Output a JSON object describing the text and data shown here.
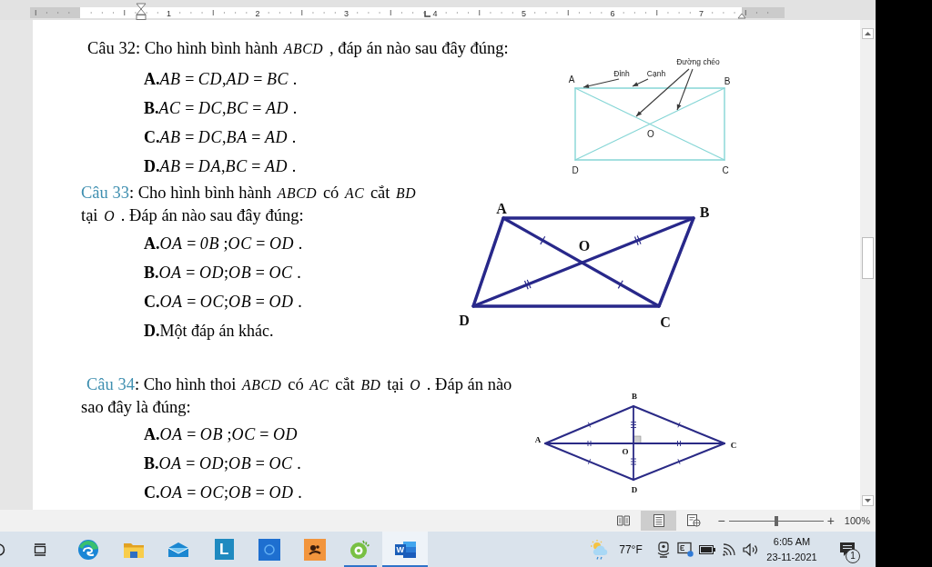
{
  "ruler": {
    "numbers": [
      "1",
      "2",
      "3",
      "4",
      "5",
      "6",
      "7"
    ]
  },
  "questions": [
    {
      "label": "Câu 32",
      "color": "#000000",
      "text": ": Cho hình bình hành *ABCD* , đáp án nào sau đây đúng:",
      "options": [
        {
          "label": "A.",
          "text": "*AB* = *CD*,*AD* = *BC* ."
        },
        {
          "label": "B.",
          "text": "*AC* = *DC*,*BC* = *AD* ."
        },
        {
          "label": "C.",
          "text": "*AB* = *DC*,*BA* = *AD* ."
        },
        {
          "label": "D.",
          "text": "*AB* = *DA*,*BC* = *AD* ."
        }
      ],
      "figure": {
        "kind": "rectangle",
        "vertices": [
          "A",
          "B",
          "D",
          "C"
        ],
        "center": "O",
        "callouts": [
          "Đỉnh",
          "Cạnh",
          "Đường chéo"
        ]
      }
    },
    {
      "label": "Câu 33",
      "color": "#3f8fb0",
      "text": ": Cho hình bình hành *ABCD* có *AC* cắt *BD* tại *O* . Đáp án nào sau đây đúng:",
      "options": [
        {
          "label": "A.",
          "text": "*OA* = *0B* ;*OC* = *OD* ."
        },
        {
          "label": "B.",
          "text": "*OA* = *OD*;*OB* = *OC* ."
        },
        {
          "label": "C.",
          "text": "*OA* = *OC*;*OB* = *OD* ."
        },
        {
          "label": "D.",
          "text": "Một đáp án khác."
        }
      ],
      "figure": {
        "kind": "parallelogram",
        "vertices": [
          "A",
          "B",
          "D",
          "C"
        ],
        "center": "O"
      }
    },
    {
      "label": "Câu 34",
      "color": "#3f8fb0",
      "text": ": Cho hình thoi *ABCD* có *AC* cắt *BD* tại *O* . Đáp án nào sao đây là đúng:",
      "options": [
        {
          "label": "A.",
          "text": "*OA* = *OB* ;*OC* = *OD*"
        },
        {
          "label": "B.",
          "text": "*OA* = *OD*;*OB* = *OC* ."
        },
        {
          "label": "C.",
          "text": "*OA* = *OC*;*OB* = *OD* ."
        }
      ],
      "figure": {
        "kind": "rhombus",
        "vertices": [
          "B",
          "A",
          "C",
          "D"
        ],
        "center": "O"
      }
    }
  ],
  "status_bar": {
    "views": [
      {
        "kind": "read",
        "selected": false
      },
      {
        "kind": "print",
        "selected": true
      },
      {
        "kind": "web",
        "selected": false
      }
    ],
    "zoom": {
      "minus": "−",
      "plus": "+",
      "level": 0.5,
      "reading": "100%"
    }
  },
  "taskbar": {
    "buttons": [
      {
        "kind": "search"
      },
      {
        "kind": "task_view"
      }
    ],
    "apps": [
      {
        "kind": "browser",
        "running": false,
        "selected": false
      },
      {
        "kind": "folder",
        "running": false,
        "selected": false
      },
      {
        "kind": "mail",
        "running": false,
        "selected": false
      },
      {
        "kind": "letter_tile",
        "glyph": "L",
        "running": false,
        "selected": false
      },
      {
        "kind": "ring_tile",
        "running": false,
        "selected": false
      },
      {
        "kind": "figure_tile",
        "running": false,
        "selected": false
      },
      {
        "kind": "spiral",
        "running": true,
        "selected": false
      },
      {
        "kind": "word",
        "glyph": "W",
        "running": true,
        "selected": true
      }
    ],
    "weather": {
      "temperature": "77°F"
    },
    "tray": [
      {
        "kind": "meet"
      },
      {
        "kind": "capture"
      },
      {
        "kind": "battery"
      },
      {
        "kind": "wifi"
      },
      {
        "kind": "volume"
      }
    ],
    "clock": {
      "time": "6:05 AM",
      "date": "23-11-2021"
    },
    "notifications": {
      "count": "1"
    }
  }
}
